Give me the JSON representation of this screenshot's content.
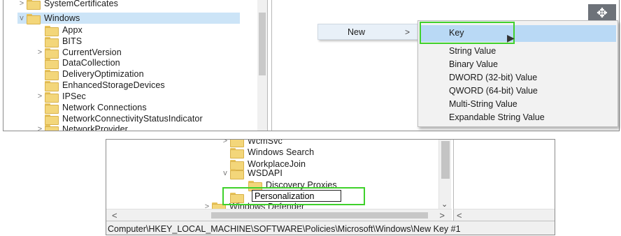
{
  "top": {
    "tree_items": [
      {
        "label": "SystemCertificates",
        "expander": ">"
      },
      {
        "label": "Windows",
        "expander": "v"
      },
      {
        "label": "Appx",
        "expander": ""
      },
      {
        "label": "BITS",
        "expander": ""
      },
      {
        "label": "CurrentVersion",
        "expander": ">"
      },
      {
        "label": "DataCollection",
        "expander": ""
      },
      {
        "label": "DeliveryOptimization",
        "expander": ""
      },
      {
        "label": "EnhancedStorageDevices",
        "expander": ""
      },
      {
        "label": "IPSec",
        "expander": ">"
      },
      {
        "label": "Network Connections",
        "expander": ""
      },
      {
        "label": "NetworkConnectivityStatusIndicator",
        "expander": ""
      },
      {
        "label": "NetworkProvider",
        "expander": ">"
      }
    ],
    "context_menu": {
      "item": "New",
      "arrow": ">"
    },
    "submenu": [
      "Key",
      "String Value",
      "Binary Value",
      "DWORD (32-bit) Value",
      "QWORD (64-bit) Value",
      "Multi-String Value",
      "Expandable String Value"
    ],
    "window_icon": "move-icon"
  },
  "bottom": {
    "tree_items": [
      {
        "label": "WcmSvc",
        "expander": ">"
      },
      {
        "label": "Windows Search",
        "expander": ""
      },
      {
        "label": "WorkplaceJoin",
        "expander": ""
      },
      {
        "label": "WSDAPI",
        "expander": "v"
      },
      {
        "label": "Discovery Proxies",
        "expander": ""
      },
      {
        "label": "",
        "expander": ""
      },
      {
        "label": "Windows Defender",
        "expander": ">"
      }
    ],
    "rename_value": "Personalization",
    "status_path": "Computer\\HKEY_LOCAL_MACHINE\\SOFTWARE\\Policies\\Microsoft\\Windows\\New Key #1",
    "scroll_left": "<",
    "scroll_right": ">",
    "scroll_down": "⌄"
  },
  "colors": {
    "highlight": "#3fd12b",
    "selection": "#b9d9f5",
    "folder": "#f3d67a"
  }
}
